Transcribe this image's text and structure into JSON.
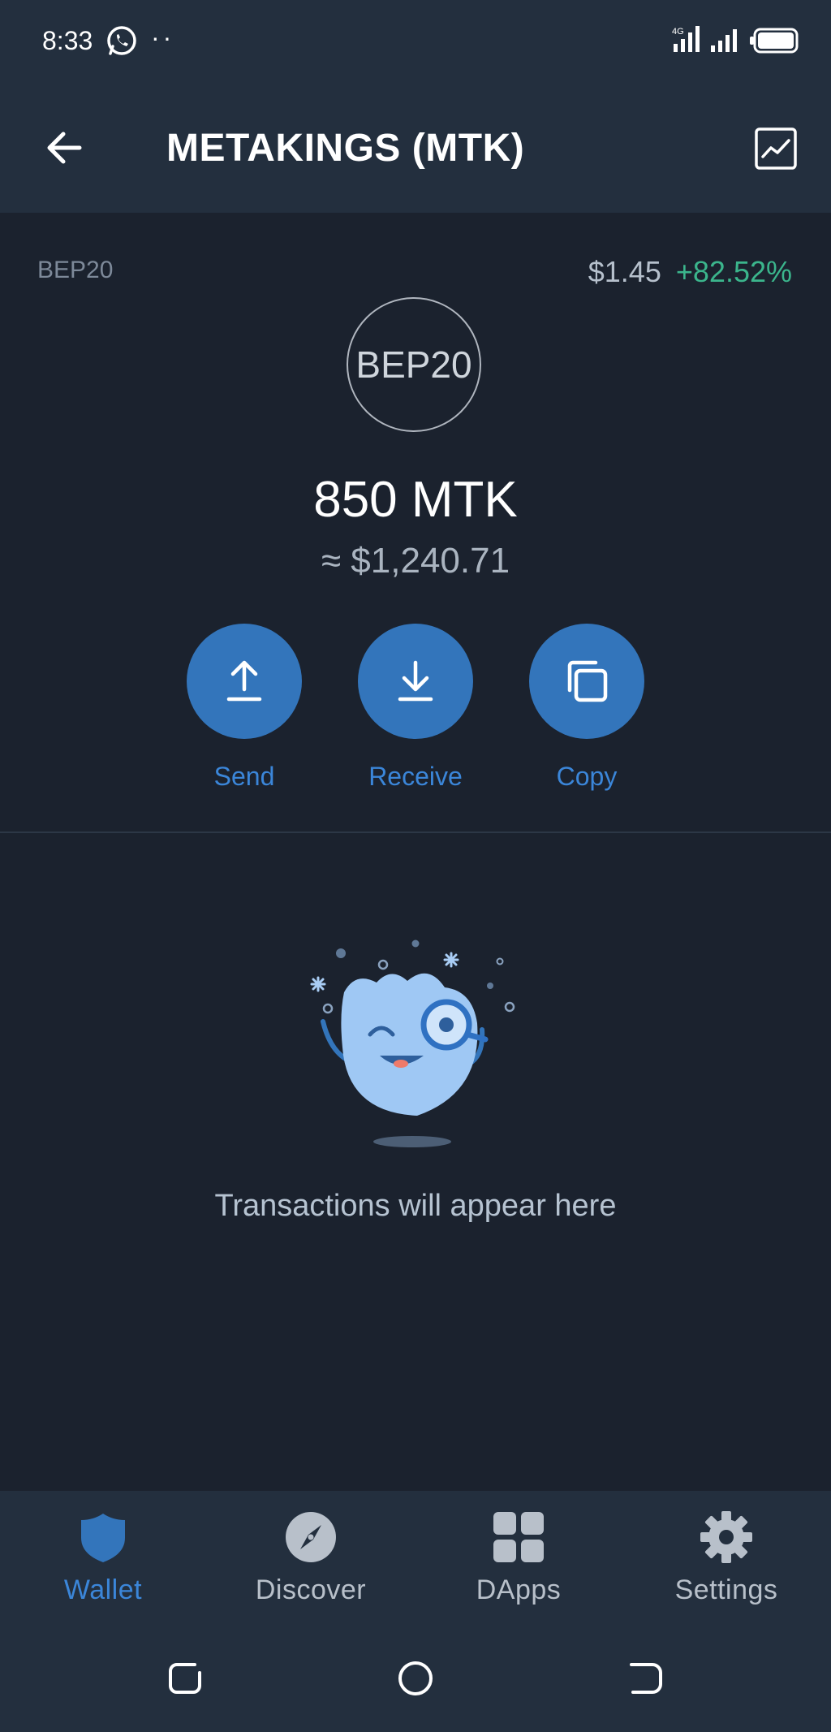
{
  "status": {
    "time": "8:33",
    "dots": "··"
  },
  "header": {
    "title": "METAKINGS (MTK)"
  },
  "token": {
    "network": "BEP20",
    "price": "$1.45",
    "change": "+82.52%",
    "logo_text": "BEP20",
    "balance": "850 MTK",
    "fiat_value": "≈ $1,240.71"
  },
  "actions": [
    {
      "label": "Send",
      "icon": "upload-icon"
    },
    {
      "label": "Receive",
      "icon": "download-icon"
    },
    {
      "label": "Copy",
      "icon": "copy-icon"
    }
  ],
  "empty_state": {
    "message": "Transactions will appear here"
  },
  "bottom_nav": [
    {
      "label": "Wallet",
      "icon": "shield-icon",
      "active": true
    },
    {
      "label": "Discover",
      "icon": "compass-icon",
      "active": false
    },
    {
      "label": "DApps",
      "icon": "grid-icon",
      "active": false
    },
    {
      "label": "Settings",
      "icon": "gear-icon",
      "active": false
    }
  ],
  "colors": {
    "background": "#1b222e",
    "bar": "#232f3e",
    "accent": "#3375bb",
    "positive": "#3bb58c"
  }
}
